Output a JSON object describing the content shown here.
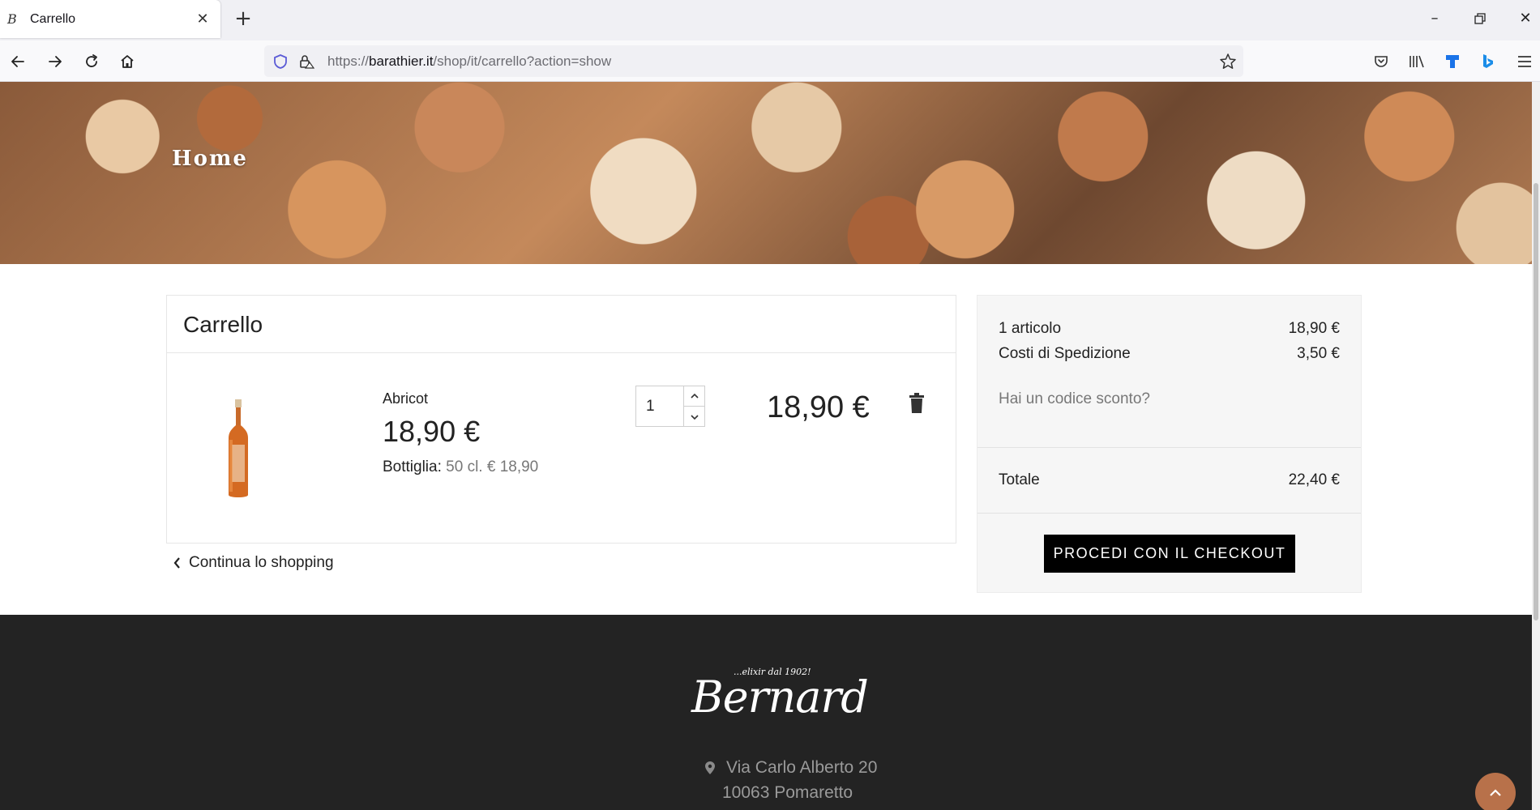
{
  "browser": {
    "tab_title": "Carrello",
    "tab_favicon": "B",
    "tab_close": "✕",
    "new_tab": "+",
    "url_prefix": "https://",
    "url_host": "barathier.it",
    "url_path": "/shop/it/carrello?action=show"
  },
  "hero": {
    "title": "Home"
  },
  "cart": {
    "title": "Carrello",
    "item": {
      "name": "Abricot",
      "price": "18,90 €",
      "meta_label": "Bottiglia:",
      "meta_value": "50 cl. € 18,90",
      "quantity": "1",
      "line_total": "18,90 €"
    },
    "continue_label": "Continua lo shopping"
  },
  "summary": {
    "items_label": "1 articolo",
    "items_value": "18,90 €",
    "shipping_label": "Costi di Spedizione",
    "shipping_value": "3,50 €",
    "discount_label": "Hai un codice sconto?",
    "total_label": "Totale",
    "total_value": "22,40 €",
    "checkout_label": "PROCEDI CON IL CHECKOUT"
  },
  "footer": {
    "logo_tagline": "...elixir dal 1902!",
    "logo_name": "Bernard",
    "address_line1": "Via Carlo Alberto 20",
    "address_line2": "10063 Pomaretto"
  },
  "colors": {
    "accent": "#b8714a",
    "footer_bg": "#232323",
    "checkout_bg": "#000000"
  }
}
